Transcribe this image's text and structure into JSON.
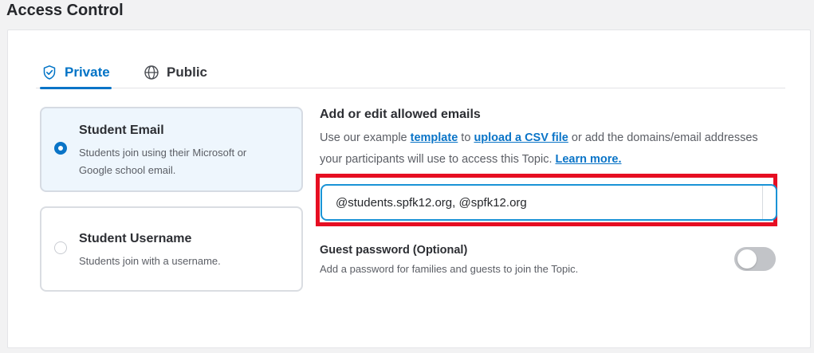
{
  "header": {
    "title": "Access Control"
  },
  "tabs": [
    {
      "label": "Private",
      "icon": "shield-check-icon",
      "active": true
    },
    {
      "label": "Public",
      "icon": "globe-icon",
      "active": false
    }
  ],
  "options": [
    {
      "title": "Student Email",
      "description": "Students join using their Microsoft or Google school email.",
      "selected": true
    },
    {
      "title": "Student Username",
      "description": "Students join with a username.",
      "selected": false
    }
  ],
  "emails": {
    "heading": "Add or edit allowed emails",
    "desc_prefix": "Use our example ",
    "template_link": "template",
    "desc_to": " to ",
    "upload_link": "upload a CSV file",
    "desc_middle": " or add the domains/email addresses your participants will use to access this Topic. ",
    "learn_more_link": "Learn more.",
    "input_value": "@students.spfk12.org, @spfk12.org"
  },
  "guest": {
    "title": "Guest password (Optional)",
    "description": "Add a password for families and guests to join the Topic.",
    "enabled": false
  },
  "colors": {
    "accent": "#0a74c7",
    "highlight": "#e60e22",
    "selected_bg": "#eef6fd"
  }
}
